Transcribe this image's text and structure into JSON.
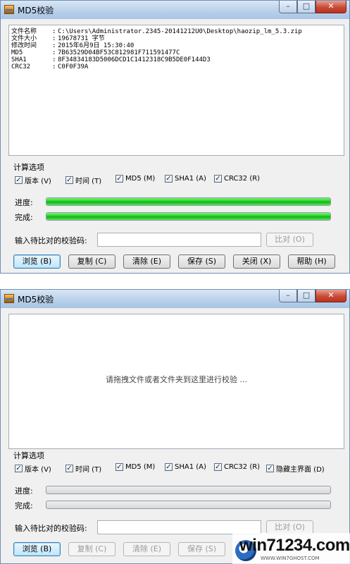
{
  "window1": {
    "title": "MD5校验",
    "controls": {
      "minimize": "–",
      "maximize": "□",
      "close": "✕"
    },
    "info": [
      {
        "label": "文件名称",
        "value": "C:\\Users\\Administrator.2345-20141212U0\\Desktop\\haozip_lm_5.3.zip"
      },
      {
        "label": "文件大小",
        "value": "19678731 字节"
      },
      {
        "label": "修改时间",
        "value": "2015年6月9日 15:30:40"
      },
      {
        "label": "MD5",
        "value": "7B63529D04BF53C812981F711591477C"
      },
      {
        "label": "SHA1",
        "value": "8F34834183D5006DCD1C1412318C9B5DE0F144D3"
      },
      {
        "label": "CRC32",
        "value": "C0F0F39A"
      }
    ],
    "options_title": "计算选项",
    "options": [
      {
        "label": "版本 (V)",
        "checked": true
      },
      {
        "label": "时间 (T)",
        "checked": true
      },
      {
        "label": "MD5 (M)",
        "checked": true
      },
      {
        "label": "SHA1 (A)",
        "checked": true
      },
      {
        "label": "CRC32 (R)",
        "checked": true
      }
    ],
    "progress_label": "进度:",
    "done_label": "完成:",
    "progress": 1.0,
    "done": 1.0,
    "compare_label": "输入待比对的校验码:",
    "compare_value": "",
    "compare_button": "比对 (O)",
    "buttons": [
      "浏览 (B)",
      "复制 (C)",
      "清除 (E)",
      "保存 (S)",
      "关闭 (X)",
      "帮助 (H)"
    ]
  },
  "window2": {
    "title": "MD5校验",
    "controls": {
      "minimize": "–",
      "maximize": "□",
      "close": "✕"
    },
    "drop_hint": "请拖拽文件或者文件夹到这里进行校验 ...",
    "options_title": "计算选项",
    "options": [
      {
        "label": "版本 (V)",
        "checked": true
      },
      {
        "label": "时间 (T)",
        "checked": true
      },
      {
        "label": "MD5 (M)",
        "checked": true
      },
      {
        "label": "SHA1 (A)",
        "checked": true
      },
      {
        "label": "CRC32 (R)",
        "checked": true
      },
      {
        "label": "隐藏主界面 (D)",
        "checked": true
      }
    ],
    "progress_label": "进度:",
    "done_label": "完成:",
    "progress": 0,
    "done": 0,
    "compare_label": "输入待比对的校验码:",
    "compare_value": "",
    "compare_button": "比对 (O)",
    "buttons": [
      "浏览 (B)",
      "复制 (C)",
      "清除 (E)",
      "保存 (S)"
    ]
  },
  "watermark": {
    "text": "win71234.com",
    "sub": "WWW.WIN7GHOST.COM"
  },
  "colors": {
    "progress_green": "#1ed21e",
    "title_blue": "#b9d1ea",
    "close_red": "#c94a35"
  }
}
